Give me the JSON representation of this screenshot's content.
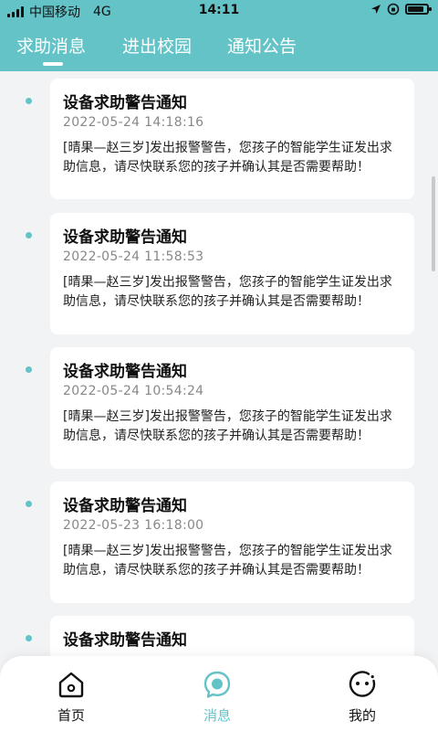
{
  "status_bar": {
    "carrier": "中国移动",
    "network": "4G",
    "time": "14:11"
  },
  "tabs": [
    {
      "label": "求助消息",
      "active": true
    },
    {
      "label": "进出校园",
      "active": false
    },
    {
      "label": "通知公告",
      "active": false
    }
  ],
  "messages": [
    {
      "title": "设备求助警告通知",
      "time": "2022-05-24 14:18:16",
      "body": "[晴果—赵三岁]发出报警警告，您孩子的智能学生证发出求助信息，请尽快联系您的孩子并确认其是否需要帮助！"
    },
    {
      "title": "设备求助警告通知",
      "time": "2022-05-24 11:58:53",
      "body": "[晴果—赵三岁]发出报警警告，您孩子的智能学生证发出求助信息，请尽快联系您的孩子并确认其是否需要帮助！"
    },
    {
      "title": "设备求助警告通知",
      "time": "2022-05-24 10:54:24",
      "body": "[晴果—赵三岁]发出报警警告，您孩子的智能学生证发出求助信息，请尽快联系您的孩子并确认其是否需要帮助！"
    },
    {
      "title": "设备求助警告通知",
      "time": "2022-05-23 16:18:00",
      "body": "[晴果—赵三岁]发出报警警告，您孩子的智能学生证发出求助信息，请尽快联系您的孩子并确认其是否需要帮助！"
    },
    {
      "title": "设备求助警告通知",
      "time": "",
      "body": ""
    }
  ],
  "bottom_nav": [
    {
      "label": "首页",
      "icon": "home-icon",
      "active": false
    },
    {
      "label": "消息",
      "icon": "message-icon",
      "active": true
    },
    {
      "label": "我的",
      "icon": "profile-icon",
      "active": false
    }
  ],
  "colors": {
    "accent": "#63c3c7",
    "background": "#f2f3f5"
  }
}
